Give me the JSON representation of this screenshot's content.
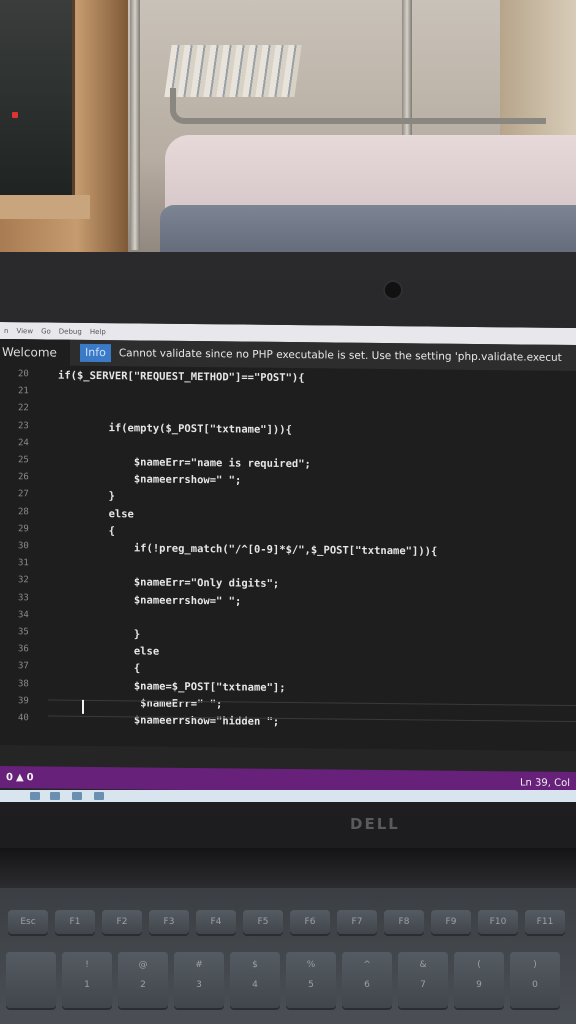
{
  "editor": {
    "menu_items": [
      "n",
      "View",
      "Go",
      "Debug",
      "Help"
    ],
    "tab_label": "Welcome",
    "notification": {
      "badge": "Info",
      "message": "Cannot validate since no PHP executable is set. Use the setting 'php.validate.execut"
    },
    "lines": [
      {
        "no": "20",
        "code": "if($_SERVER[\"REQUEST_METHOD\"]==\"POST\"){"
      },
      {
        "no": "21",
        "code": ""
      },
      {
        "no": "22",
        "code": ""
      },
      {
        "no": "23",
        "code": "        if(empty($_POST[\"txtname\"])){"
      },
      {
        "no": "24",
        "code": ""
      },
      {
        "no": "25",
        "code": "            $nameErr=\"name is required\";"
      },
      {
        "no": "26",
        "code": "            $nameerrshow=\" \";"
      },
      {
        "no": "27",
        "code": "        }"
      },
      {
        "no": "28",
        "code": "        else"
      },
      {
        "no": "29",
        "code": "        {"
      },
      {
        "no": "30",
        "code": "            if(!preg_match(\"/^[0-9]*$/\",$_POST[\"txtname\"])){"
      },
      {
        "no": "31",
        "code": ""
      },
      {
        "no": "32",
        "code": "            $nameErr=\"Only digits\";"
      },
      {
        "no": "33",
        "code": "            $nameerrshow=\" \";"
      },
      {
        "no": "34",
        "code": ""
      },
      {
        "no": "35",
        "code": "            }"
      },
      {
        "no": "36",
        "code": "            else"
      },
      {
        "no": "37",
        "code": "            {"
      },
      {
        "no": "38",
        "code": "            $name=$_POST[\"txtname\"];"
      },
      {
        "no": "39",
        "code": "             $nameErr=\" \";"
      },
      {
        "no": "40",
        "code": "            $nameerrshow=\"hidden \";"
      }
    ],
    "status": {
      "errors": "0",
      "warnings": "0",
      "position": "Ln 39, Col"
    }
  },
  "laptop": {
    "brand": "DELL",
    "keys_top": [
      "Esc",
      "F1",
      "F2",
      "F3",
      "F4",
      "F5",
      "F6",
      "F7",
      "F8",
      "F9",
      "F10",
      "F11"
    ],
    "keys_num": [
      "",
      "!",
      "@",
      "#",
      "$",
      "%",
      "^",
      "&",
      "(",
      ")"
    ],
    "keys_num_lower": [
      "",
      "1",
      "2",
      "3",
      "4",
      "5",
      "6",
      "7",
      "9",
      "0"
    ]
  }
}
